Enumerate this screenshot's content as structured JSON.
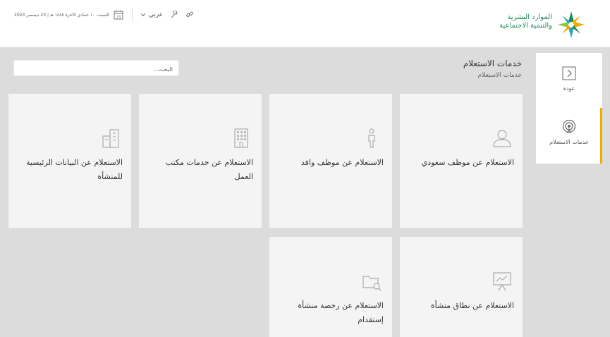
{
  "header": {
    "logo_line1": "الموارد البشرية",
    "logo_line2": "والتنمية الاجتماعية",
    "date": "السبت، ١٠ جمادي الآخرة ١٤٤٥ هـ | 23 ديسمبر 2023",
    "calendar_day": "23",
    "language": "عربي"
  },
  "sidenav": {
    "back_label": "عودة",
    "services_label": "خدمات الاستعلام"
  },
  "page": {
    "title": "خدمات الاستعلام",
    "breadcrumb": "خدمات الاستعلام"
  },
  "search": {
    "placeholder": "البحث..."
  },
  "cards": [
    {
      "title": "الاستعلام عن موظف سعودي",
      "icon": "person-icon"
    },
    {
      "title": "الاستعلام عن موظف وافد",
      "icon": "person-standing-icon"
    },
    {
      "title": "الاستعلام عن خدمات مكتب العمل",
      "icon": "office-building-icon"
    },
    {
      "title": "الاستعلام عن البيانات الرئيسية للمنشأة",
      "icon": "buildings-icon"
    },
    {
      "title": "الاستعلام عن نطاق منشأة",
      "icon": "presentation-chart-icon"
    },
    {
      "title": "الاستعلام عن رخصة منشأة إستقدام",
      "icon": "folder-search-icon"
    }
  ],
  "colors": {
    "accent": "#f2a900",
    "brand_green": "#1f8c5a",
    "page_bg": "#dcdcdc",
    "card_bg": "#f4f4f4"
  }
}
